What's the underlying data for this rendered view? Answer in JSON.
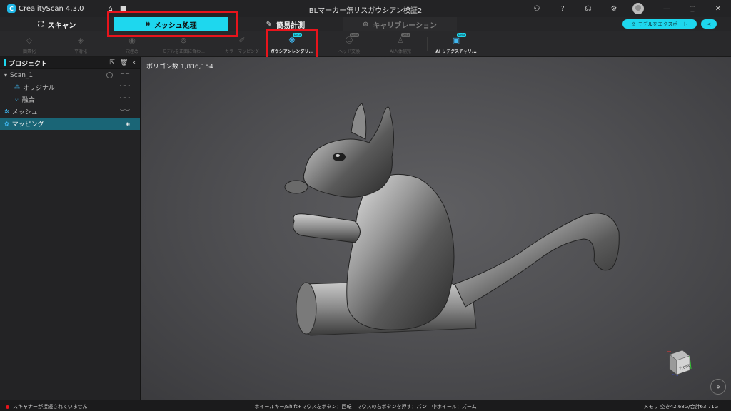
{
  "app": {
    "name": "CrealityScan 4.3.0",
    "document_title": "BLマーカー無リスガウシアン検証2"
  },
  "titlebar_icons": [
    "home-icon",
    "folder-icon",
    "community-icon",
    "help-icon",
    "support-icon",
    "settings-icon",
    "avatar",
    "minimize-icon",
    "maximize-icon",
    "close-icon"
  ],
  "tabs": [
    {
      "label": "スキャン",
      "icon": "scan-icon",
      "state": "normal"
    },
    {
      "label": "メッシュ処理",
      "icon": "mesh-icon",
      "state": "active"
    },
    {
      "label": "簡易計測",
      "icon": "ruler-icon",
      "state": "normal"
    },
    {
      "label": "キャリブレーション",
      "icon": "calibration-icon",
      "state": "disabled"
    }
  ],
  "actions": {
    "export_label": "モデルをエクスポート",
    "share_icon": "share-icon"
  },
  "toolbar": [
    {
      "label": "簡素化",
      "icon": "simplify-icon",
      "enabled": false,
      "beta": false
    },
    {
      "label": "平滑化",
      "icon": "smooth-icon",
      "enabled": false,
      "beta": false
    },
    {
      "label": "穴埋め",
      "icon": "fill-hole-icon",
      "enabled": false,
      "beta": false
    },
    {
      "label": "モデルを正面に合わ...",
      "icon": "align-icon",
      "enabled": false,
      "beta": false
    },
    {
      "label": "カラーマッピング",
      "icon": "color-map-icon",
      "enabled": false,
      "beta": false
    },
    {
      "label": "ガウシアンレンダリ...",
      "icon": "gaussian-icon",
      "enabled": true,
      "beta": true
    },
    {
      "label": "ヘッド交換",
      "icon": "head-swap-icon",
      "enabled": false,
      "beta": true
    },
    {
      "label": "AI人体補完",
      "icon": "ai-body-icon",
      "enabled": false,
      "beta": true
    },
    {
      "label": "AI リテクスチャリ...",
      "icon": "ai-retexture-icon",
      "enabled": true,
      "beta": true
    }
  ],
  "beta_badge": "beta",
  "project": {
    "title": "プロジェクト",
    "items": [
      {
        "label": "Scan_1",
        "level": 0,
        "icon": "caret-down-icon",
        "selected": false,
        "visible": false
      },
      {
        "label": "オリジナル",
        "level": 1,
        "icon": "original-icon",
        "selected": false,
        "visible": false
      },
      {
        "label": "融合",
        "level": 1,
        "icon": "fusion-icon",
        "selected": false,
        "visible": false
      },
      {
        "label": "メッシュ",
        "level": 0,
        "icon": "mesh-item-icon",
        "selected": false,
        "visible": false
      },
      {
        "label": "マッピング",
        "level": 0,
        "icon": "mapping-icon",
        "selected": true,
        "visible": true
      }
    ]
  },
  "viewport": {
    "polygon_count": "ポリゴン数 1,836,154",
    "cube_face": "Front"
  },
  "status": {
    "scanner": "スキャナーが接続されていません",
    "hint": "ホイールキー/Shift+マウス左ボタン：回転　マウスの右ボタンを押す：パン　中ホイール：ズーム",
    "memory": "メモリ 空き42.68G/合計63.71G"
  },
  "colors": {
    "accent": "#1ed7ee",
    "highlight_box": "#e8141c",
    "selected_row": "#1a6576"
  }
}
